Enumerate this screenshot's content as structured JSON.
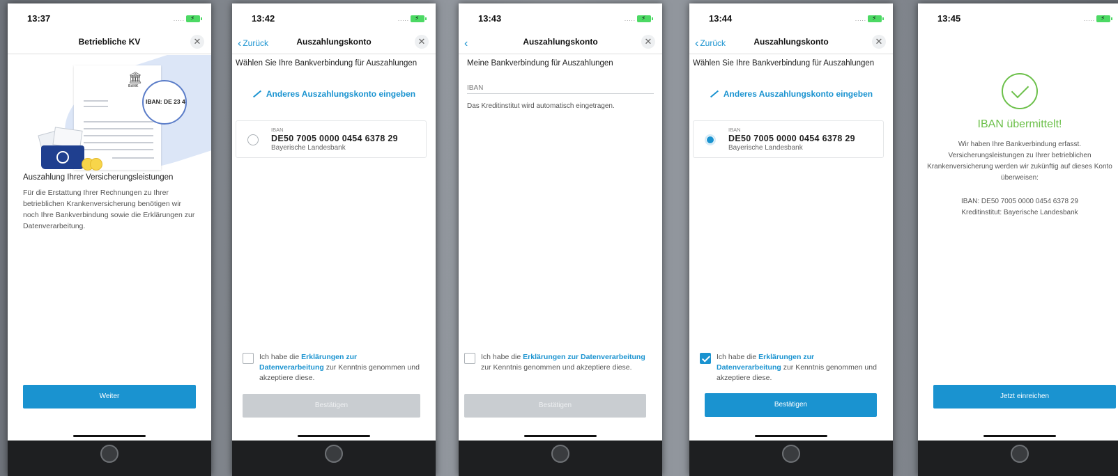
{
  "screens": [
    {
      "time": "13:37",
      "nav_title": "Betriebliche KV",
      "illustration": {
        "bank_label": "BANK",
        "iban_snippet": "IBAN: DE 23 4"
      },
      "heading": "Auszahlung Ihrer Versicherungsleistungen",
      "body": "Für die Erstattung Ihrer Rechnungen zu Ihrer betrieblichen Krankenversicherung benötigen wir noch Ihre Bankverbindung sowie die Erklärungen zur Datenverarbeitung.",
      "button": "Weiter"
    },
    {
      "time": "13:42",
      "back_label": "Zurück",
      "nav_title": "Auszahlungskonto",
      "heading": "Wählen Sie Ihre Bankverbindung für Auszahlungen",
      "edit_link": "Anderes Auszahlungskonto eingeben",
      "account": {
        "label": "IBAN",
        "iban": "DE50 7005 0000 0454 6378 29",
        "bank": "Bayerische Landesbank",
        "selected": false
      },
      "consent": {
        "prefix": "Ich habe die ",
        "link": "Erklärungen zur Datenverarbeitung",
        "suffix": " zur Kenntnis genommen und akzeptiere diese.",
        "checked": false
      },
      "button": "Bestätigen"
    },
    {
      "time": "13:43",
      "nav_title": "Auszahlungskonto",
      "heading": "Meine Bankverbindung für Auszahlungen",
      "field_placeholder": "IBAN",
      "hint": "Das Kreditinstitut wird automatisch eingetragen.",
      "consent": {
        "prefix": "Ich habe die ",
        "link": "Erklärungen zur Datenverarbeitung",
        "suffix": " zur Kenntnis genommen und akzeptiere diese.",
        "checked": false
      },
      "button": "Bestätigen"
    },
    {
      "time": "13:44",
      "back_label": "Zurück",
      "nav_title": "Auszahlungskonto",
      "heading": "Wählen Sie Ihre Bankverbindung für Auszahlungen",
      "edit_link": "Anderes Auszahlungskonto eingeben",
      "account": {
        "label": "IBAN",
        "iban": "DE50 7005 0000 0454 6378 29",
        "bank": "Bayerische Landesbank",
        "selected": true
      },
      "consent": {
        "prefix": "Ich habe die ",
        "link": "Erklärungen zur Datenverarbeitung",
        "suffix": " zur Kenntnis genommen und akzeptiere diese.",
        "checked": true
      },
      "button": "Bestätigen"
    },
    {
      "time": "13:45",
      "success_title": "IBAN übermittelt!",
      "success_text": "Wir haben Ihre Bankverbindung erfasst. Versicherungsleistungen zu Ihrer betrieblichen Krankenversicherung werden wir zukünftig auf dieses Konto überweisen:",
      "iban_line": "IBAN: DE50 7005 0000 0454 6378 29",
      "bank_line": "Kreditinstitut: Bayerische Landesbank",
      "button": "Jetzt einreichen"
    }
  ],
  "status_signal": ".....",
  "colors": {
    "accent": "#1a93d0",
    "success": "#6cc04a",
    "disabled": "#c9cdd1"
  }
}
